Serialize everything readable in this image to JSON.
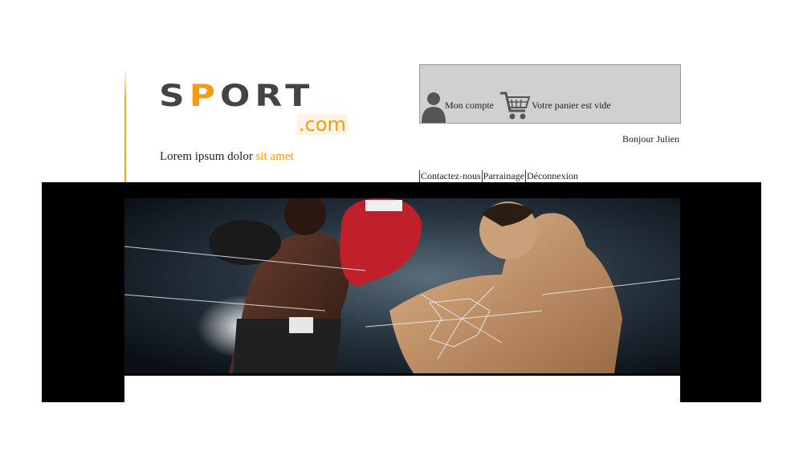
{
  "logo": {
    "s": "S",
    "p": "P",
    "ort": "ORT",
    "com": ".com"
  },
  "tagline": {
    "main": "Lorem ipsum dolor",
    "highlight": "sit amet"
  },
  "account": {
    "my_account": "Mon compte",
    "cart": "Votre panier est vide"
  },
  "greeting": "Bonjour Julien",
  "nav": {
    "items": [
      "Contactez-nous",
      "Parrainage",
      "Déconnexion"
    ]
  },
  "colors": {
    "accent": "#f39c12",
    "logo_gray": "#444444",
    "account_box": "#d0d0d0"
  },
  "icons": {
    "user": "user-icon",
    "cart": "cart-icon"
  }
}
